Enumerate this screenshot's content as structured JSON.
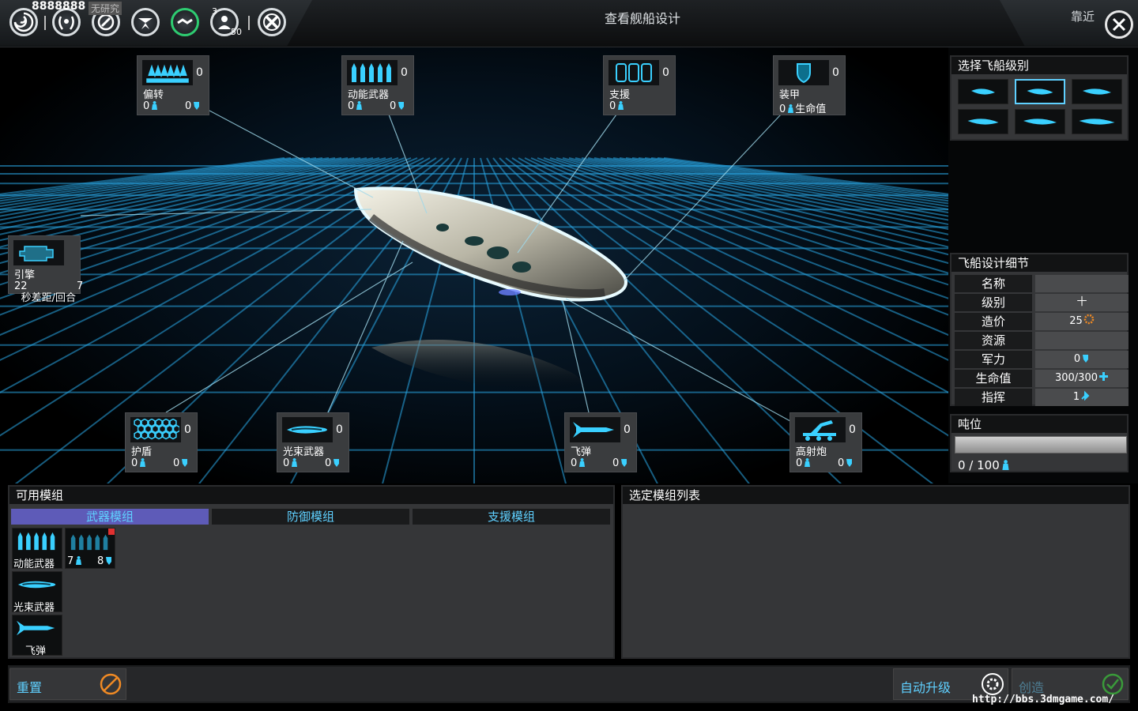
{
  "colors": {
    "accent": "#5fd0ff",
    "selected_tab": "#5e5bb8",
    "panel": "#353638"
  },
  "top_bar": {
    "money": "8888888",
    "research_tag": "无研究",
    "badge_count": "3",
    "badge_sub": "50",
    "title": "查看舰船设计",
    "zoom_label": "靠近",
    "icons": [
      "galaxy-icon",
      "laurel-icon",
      "research-icon",
      "fleet-icon",
      "diplomacy-icon",
      "population-icon",
      "tools-icon",
      "close-icon"
    ]
  },
  "slots": {
    "deflect": {
      "name": "偏转",
      "count": "0",
      "stat1": "0",
      "stat2": "0"
    },
    "kinetic": {
      "name": "动能武器",
      "count": "0",
      "stat1": "0",
      "stat2": "0"
    },
    "support": {
      "name": "支援",
      "count": "0",
      "stat1": "0"
    },
    "armor": {
      "name": "装甲",
      "count": "0",
      "stat1": "0",
      "stat_label": "生命值"
    },
    "engine": {
      "name": "引擎",
      "v1": "22",
      "v2": "7",
      "note": "秒差距/回合"
    },
    "shield": {
      "name": "护盾",
      "count": "0",
      "stat1": "0",
      "stat2": "0"
    },
    "beam": {
      "name": "光束武器",
      "count": "0",
      "stat1": "0",
      "stat2": "0"
    },
    "missile": {
      "name": "飞弹",
      "count": "0",
      "stat1": "0",
      "stat2": "0"
    },
    "flak": {
      "name": "高射炮",
      "count": "0",
      "stat1": "0",
      "stat2": "0"
    }
  },
  "class_panel": {
    "title": "选择飞船级别",
    "selected_index": 1
  },
  "details": {
    "title": "飞船设计细节",
    "rows": [
      {
        "key": "名称",
        "value": ""
      },
      {
        "key": "级别",
        "value": "十"
      },
      {
        "key": "造价",
        "value": "25"
      },
      {
        "key": "资源",
        "value": ""
      },
      {
        "key": "军力",
        "value": "0"
      },
      {
        "key": "生命值",
        "value": "300/300"
      },
      {
        "key": "指挥",
        "value": "1"
      }
    ]
  },
  "tonnage": {
    "title": "吨位",
    "text": "0 / 100",
    "fill_fraction": 0.0
  },
  "modules_panel": {
    "title": "可用模组",
    "tabs": [
      "武器模组",
      "防御模组",
      "支援模组"
    ],
    "active_tab": 0,
    "items": [
      {
        "name": "动能武器"
      },
      {
        "name": "",
        "stat1": "7",
        "stat2": "8"
      },
      {
        "name": "光束武器"
      },
      {
        "name": "飞弹"
      }
    ]
  },
  "selected_panel": {
    "title": "选定模组列表"
  },
  "buttons": {
    "reset": "重置",
    "auto_upgrade": "自动升级",
    "create": "创造"
  },
  "watermark": "http://bbs.3dmgame.com/"
}
